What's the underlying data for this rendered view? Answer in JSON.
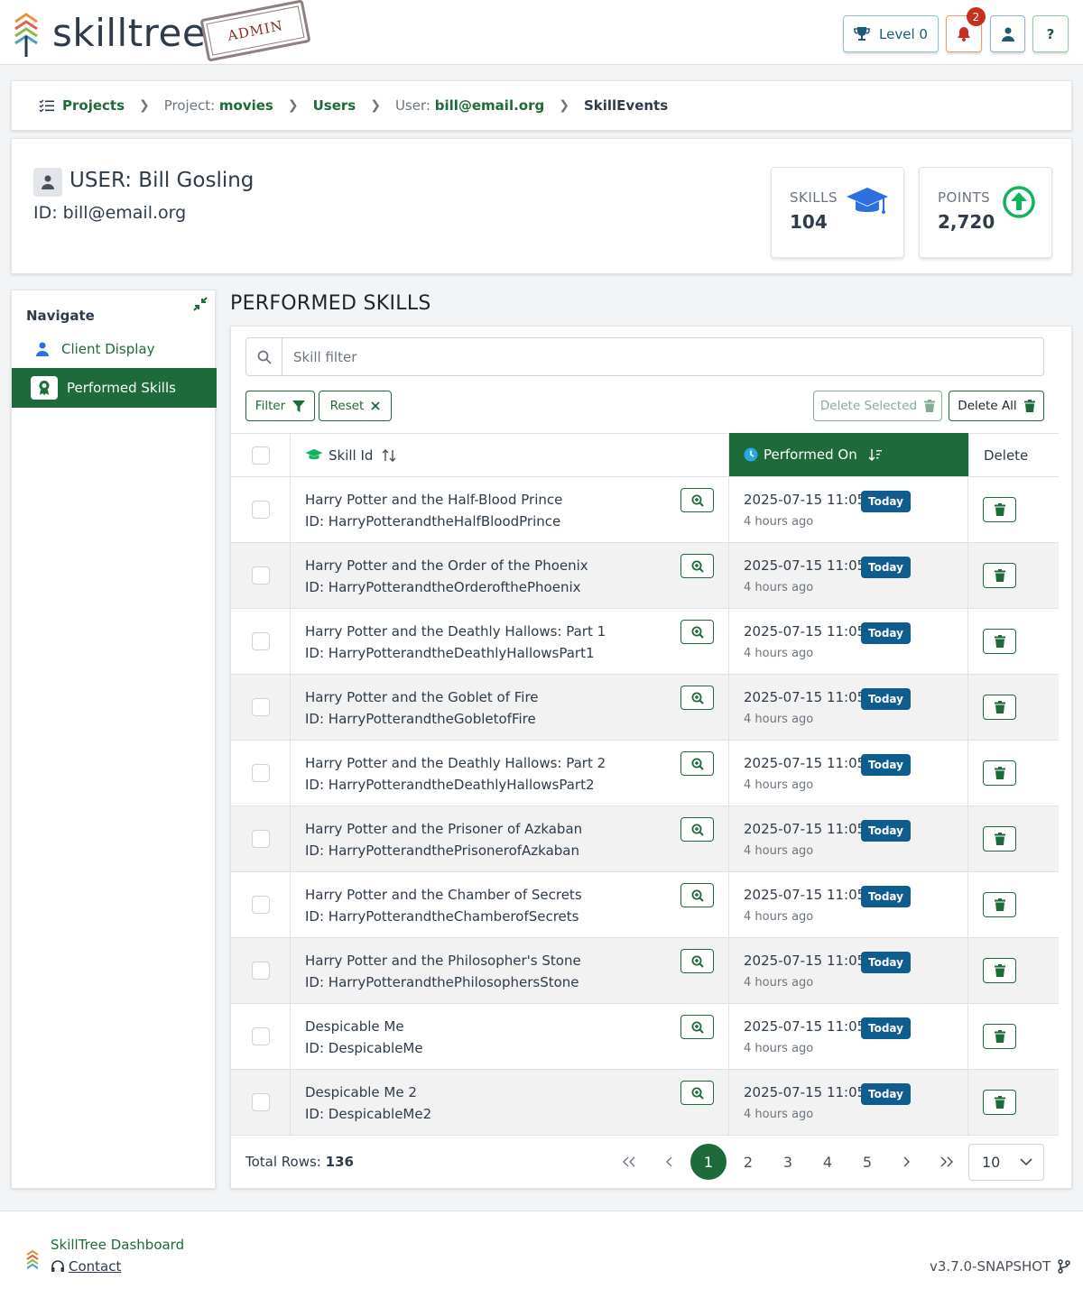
{
  "header": {
    "logo_text": "skilltree",
    "admin_stamp": "ADMIN",
    "level_label": "Level 0",
    "notification_count": "2",
    "help_label": "?"
  },
  "breadcrumb": {
    "projects": "Projects",
    "project_label": "Project:",
    "project_value": "movies",
    "users": "Users",
    "user_label": "User:",
    "user_value": "bill@email.org",
    "current": "SkillEvents"
  },
  "user_card": {
    "title": "USER: Bill Gosling",
    "id_line": "ID: bill@email.org",
    "skills_label": "SKILLS",
    "skills_value": "104",
    "points_label": "POINTS",
    "points_value": "2,720"
  },
  "sidebar": {
    "title": "Navigate",
    "items": [
      {
        "label": "Client Display"
      },
      {
        "label": "Performed Skills"
      }
    ]
  },
  "main": {
    "section_title": "PERFORMED SKILLS",
    "search_placeholder": "Skill filter",
    "filter_label": "Filter",
    "reset_label": "Reset",
    "delete_selected_label": "Delete Selected",
    "delete_all_label": "Delete All"
  },
  "table": {
    "columns": {
      "skill_id": "Skill Id",
      "performed_on": "Performed On",
      "delete": "Delete"
    },
    "rows": [
      {
        "name": "Harry Potter and the Half-Blood Prince",
        "id": "ID: HarryPotterandtheHalfBloodPrince",
        "date": "2025-07-15 11:05",
        "badge": "Today",
        "ago": "4 hours ago"
      },
      {
        "name": "Harry Potter and the Order of the Phoenix",
        "id": "ID: HarryPotterandtheOrderofthePhoenix",
        "date": "2025-07-15 11:05",
        "badge": "Today",
        "ago": "4 hours ago"
      },
      {
        "name": "Harry Potter and the Deathly Hallows: Part 1",
        "id": "ID: HarryPotterandtheDeathlyHallowsPart1",
        "date": "2025-07-15 11:05",
        "badge": "Today",
        "ago": "4 hours ago"
      },
      {
        "name": "Harry Potter and the Goblet of Fire",
        "id": "ID: HarryPotterandtheGobletofFire",
        "date": "2025-07-15 11:05",
        "badge": "Today",
        "ago": "4 hours ago"
      },
      {
        "name": "Harry Potter and the Deathly Hallows: Part 2",
        "id": "ID: HarryPotterandtheDeathlyHallowsPart2",
        "date": "2025-07-15 11:05",
        "badge": "Today",
        "ago": "4 hours ago"
      },
      {
        "name": "Harry Potter and the Prisoner of Azkaban",
        "id": "ID: HarryPotterandthePrisonerofAzkaban",
        "date": "2025-07-15 11:05",
        "badge": "Today",
        "ago": "4 hours ago"
      },
      {
        "name": "Harry Potter and the Chamber of Secrets",
        "id": "ID: HarryPotterandtheChamberofSecrets",
        "date": "2025-07-15 11:05",
        "badge": "Today",
        "ago": "4 hours ago"
      },
      {
        "name": "Harry Potter and the Philosopher's Stone",
        "id": "ID: HarryPotterandthePhilosophersStone",
        "date": "2025-07-15 11:05",
        "badge": "Today",
        "ago": "4 hours ago"
      },
      {
        "name": "Despicable Me",
        "id": "ID: DespicableMe",
        "date": "2025-07-15 11:05",
        "badge": "Today",
        "ago": "4 hours ago"
      },
      {
        "name": "Despicable Me 2",
        "id": "ID: DespicableMe2",
        "date": "2025-07-15 11:05",
        "badge": "Today",
        "ago": "4 hours ago"
      }
    ]
  },
  "pagination": {
    "total_label": "Total Rows:",
    "total_value": "136",
    "pages": [
      "1",
      "2",
      "3",
      "4",
      "5"
    ],
    "active_page": "1",
    "page_size": "10"
  },
  "footer": {
    "title": "SkillTree Dashboard",
    "contact": "Contact",
    "version": "v3.7.0-SNAPSHOT"
  },
  "colors": {
    "primary_green": "#1e6a3b",
    "badge_blue": "#0f5c8e",
    "notification_red": "#c6311f"
  },
  "icons": [
    "trophy-icon",
    "bell-icon",
    "user-icon",
    "graduation-cap-icon",
    "arrow-circle-up-icon",
    "compress-icon",
    "award-icon",
    "search-icon",
    "filter-icon",
    "close-icon",
    "trash-icon",
    "sort-icon",
    "clock-icon",
    "zoom-in-icon",
    "chevron-down-icon",
    "headset-icon",
    "code-branch-icon",
    "checklist-icon"
  ]
}
